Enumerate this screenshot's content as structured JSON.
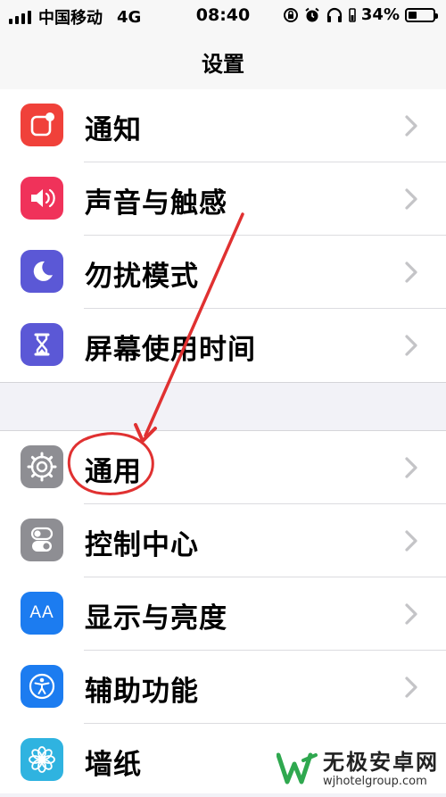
{
  "status_bar": {
    "carrier": "中国移动",
    "network": "4G",
    "time": "08:40",
    "battery_percent": "34%",
    "battery_level": 0.34,
    "icons": [
      "signal-icon",
      "rotation-lock-icon",
      "alarm-icon",
      "headphones-icon",
      "battery-icon"
    ]
  },
  "nav": {
    "title": "设置"
  },
  "groups": [
    {
      "items": [
        {
          "label": "通知",
          "icon": "notifications-icon",
          "color": "#f0413a"
        },
        {
          "label": "声音与触感",
          "icon": "speaker-icon",
          "color": "#f0325a"
        },
        {
          "label": "勿扰模式",
          "icon": "moon-icon",
          "color": "#5b58d6"
        },
        {
          "label": "屏幕使用时间",
          "icon": "hourglass-icon",
          "color": "#5b58d6"
        }
      ]
    },
    {
      "items": [
        {
          "label": "通用",
          "icon": "gear-icon",
          "color": "#8e8e93"
        },
        {
          "label": "控制中心",
          "icon": "toggles-icon",
          "color": "#8e8e93"
        },
        {
          "label": "显示与亮度",
          "icon": "text-size-icon",
          "color": "#1c7cf0",
          "icon_text": "AA"
        },
        {
          "label": "辅助功能",
          "icon": "accessibility-icon",
          "color": "#1c7cf0"
        },
        {
          "label": "墙纸",
          "icon": "flower-icon",
          "color": "#2fb3e0"
        }
      ]
    }
  ],
  "annotation": {
    "color": "#e03131",
    "highlighted_item": "通用"
  },
  "watermark": {
    "text": "无极安卓网",
    "url": "wjhotelgroup.com"
  }
}
